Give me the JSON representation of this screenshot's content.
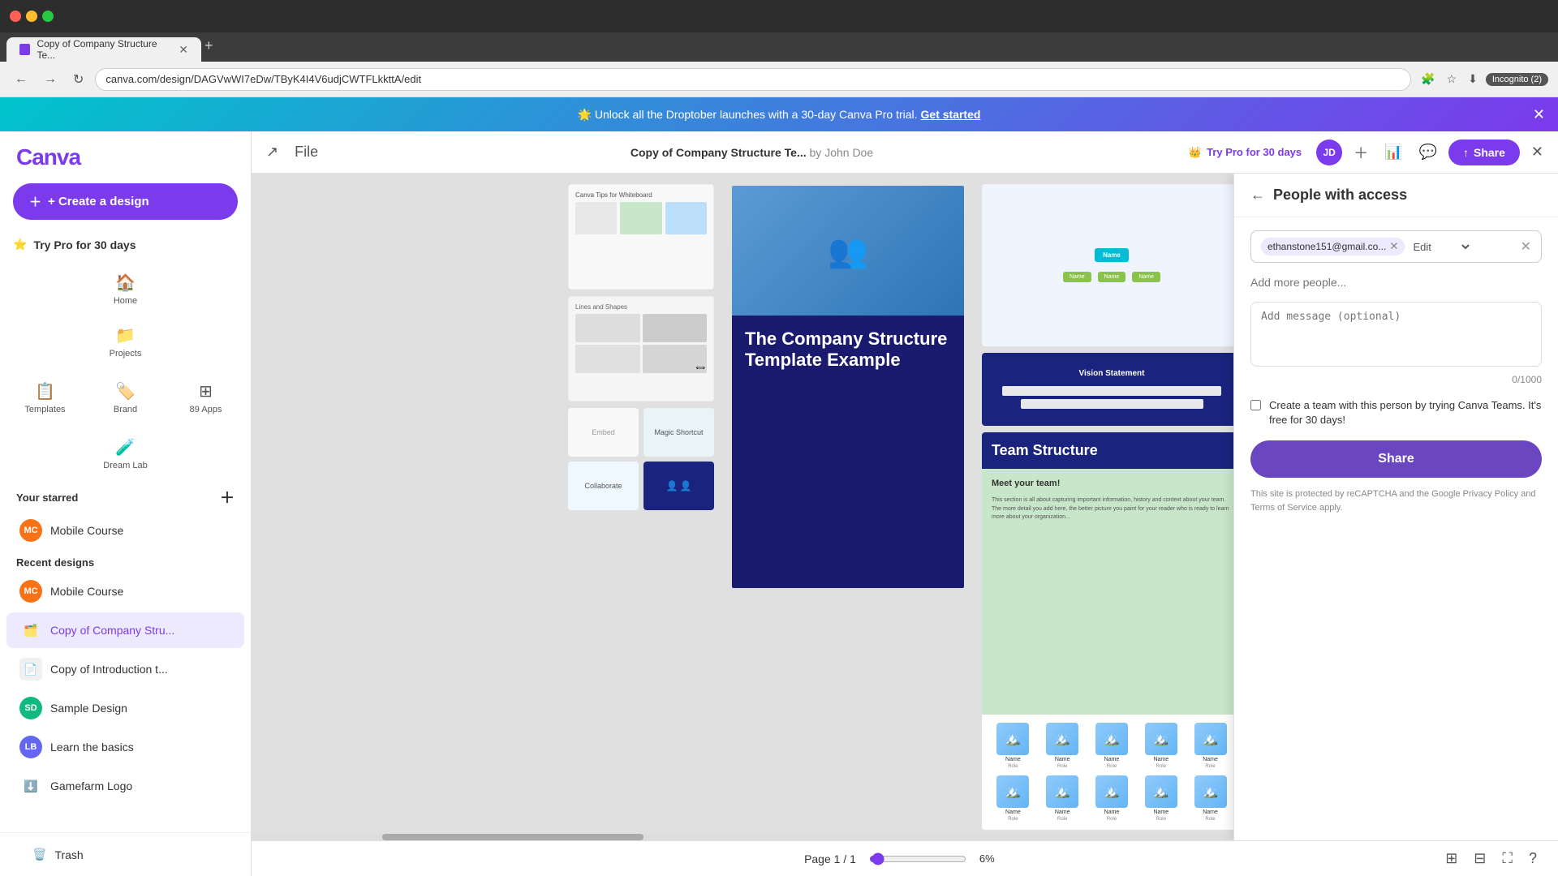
{
  "browser": {
    "tab_title": "Copy of Company Structure Te...",
    "url": "canva.com/design/DAGVwWI7eDw/TByK4I4V6udjCWTFLkkttA/edit",
    "incognito_label": "Incognito (2)",
    "new_tab_label": "+"
  },
  "promo": {
    "text": "🌟 Unlock all the Droptober launches with a 30-day Canva Pro trial.",
    "cta": "Get started"
  },
  "sidebar": {
    "logo": "Canva",
    "create_btn": "+ Create a design",
    "try_pro": "Try Pro for 30 days",
    "nav_items": [
      {
        "icon": "🏠",
        "label": "Home"
      },
      {
        "icon": "📁",
        "label": "Projects"
      },
      {
        "icon": "📋",
        "label": "Templates"
      },
      {
        "icon": "🏷️",
        "label": "Brand"
      },
      {
        "icon": "⚙️",
        "label": "Apps"
      },
      {
        "icon": "🧪",
        "label": "Dream Lab"
      }
    ],
    "starred_section": "Your starred",
    "starred_items": [
      {
        "label": "Mobile Course",
        "color": "#f97316"
      }
    ],
    "recent_section": "Recent designs",
    "recent_items": [
      {
        "label": "Mobile Course",
        "color": "#f97316",
        "icon": "📱"
      },
      {
        "label": "Copy of Company Stru...",
        "color": "#6366f1",
        "icon": "🗂️",
        "active": true
      },
      {
        "label": "Copy of Introduction t...",
        "color": "#94a3b8",
        "icon": "📄"
      },
      {
        "label": "Sample Design",
        "color": "#10b981",
        "icon": "🎨"
      },
      {
        "label": "Learn the basics",
        "color": "#6366f1",
        "icon": "📚"
      },
      {
        "label": "Gamefarm Logo",
        "color": "#64748b",
        "icon": "⬇️"
      }
    ],
    "trash_label": "Trash"
  },
  "editor": {
    "file_label": "File",
    "document_title": "Copy of Company Structure Te...",
    "author": "by John Doe",
    "try_pro_label": "Try Pro for 30 days",
    "share_label": "Share"
  },
  "footer": {
    "page_label": "Page",
    "page_current": "1",
    "page_total": "1",
    "zoom_level": "6%"
  },
  "share_panel": {
    "title": "People with access",
    "email_value": "ethanstone151@gmail.co...",
    "permission": "Edit",
    "add_more_placeholder": "Add more people...",
    "message_placeholder": "Add message (optional)",
    "char_count": "0/1000",
    "team_checkbox_text": "Create a team with this person by trying Canva Teams. It's free for 30 days!",
    "share_btn": "Share",
    "recaptcha_text": "This site is protected by reCAPTCHA and the Google Privacy Policy and Terms of Service apply."
  },
  "canvas": {
    "whiteboard_title": "Canva Tips for Whiteboard",
    "company_title": "The Company Structure Template Example",
    "vision_title": "Vision Statement",
    "team_title": "Team Structure",
    "meet_text": "Meet your team!"
  }
}
